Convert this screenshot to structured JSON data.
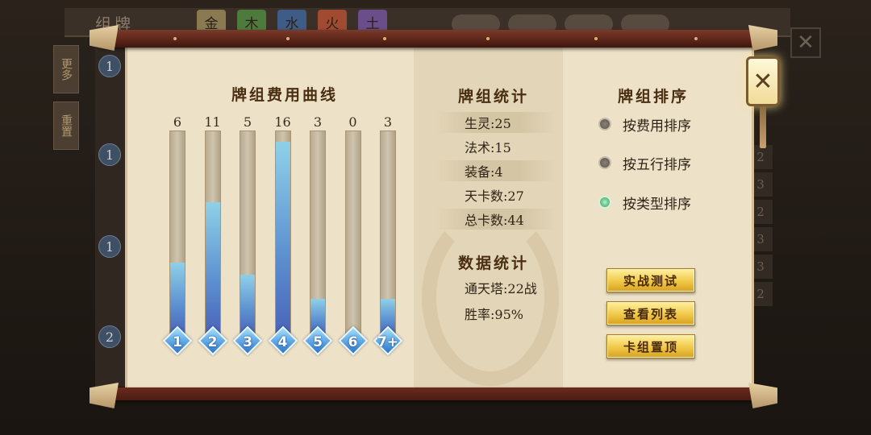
{
  "background": {
    "title": "组牌",
    "element_tabs": [
      {
        "label": "金",
        "color": "#8a7a52"
      },
      {
        "label": "木",
        "color": "#4e7a3e"
      },
      {
        "label": "水",
        "color": "#3e5c86"
      },
      {
        "label": "火",
        "color": "#a04a32"
      },
      {
        "label": "土",
        "color": "#6a4e8a"
      }
    ],
    "side_buttons": [
      "更多",
      "重置"
    ],
    "left_numbers": [
      "1",
      "1",
      "1",
      "2"
    ],
    "right_numbers": [
      "2",
      "3",
      "2",
      "3",
      "3",
      "2"
    ]
  },
  "close_icon": "close-icon",
  "cost_curve": {
    "title": "牌组费用曲线",
    "costs": [
      "1",
      "2",
      "3",
      "4",
      "5",
      "6",
      "7+"
    ],
    "counts": [
      6,
      11,
      5,
      16,
      3,
      0,
      3
    ],
    "max": 17
  },
  "deck_stats": {
    "title": "牌组统计",
    "rows": [
      "生灵:25",
      "法术:15",
      "装备:4",
      "天卡数:27",
      "总卡数:44"
    ]
  },
  "data_stats": {
    "title": "数据统计",
    "rows": [
      "通天塔:22战",
      "胜率:95%"
    ]
  },
  "sort": {
    "title": "牌组排序",
    "options": [
      {
        "label": "按费用排序",
        "selected": false
      },
      {
        "label": "按五行排序",
        "selected": false
      },
      {
        "label": "按类型排序",
        "selected": true
      }
    ]
  },
  "buttons": {
    "test": "实战测试",
    "view_list": "查看列表",
    "pin_deck": "卡组置顶"
  },
  "colors": {
    "bar_fill": "#5c8fcf",
    "selected_radio": "#2f9a58",
    "button_gold": "#f0c848"
  }
}
